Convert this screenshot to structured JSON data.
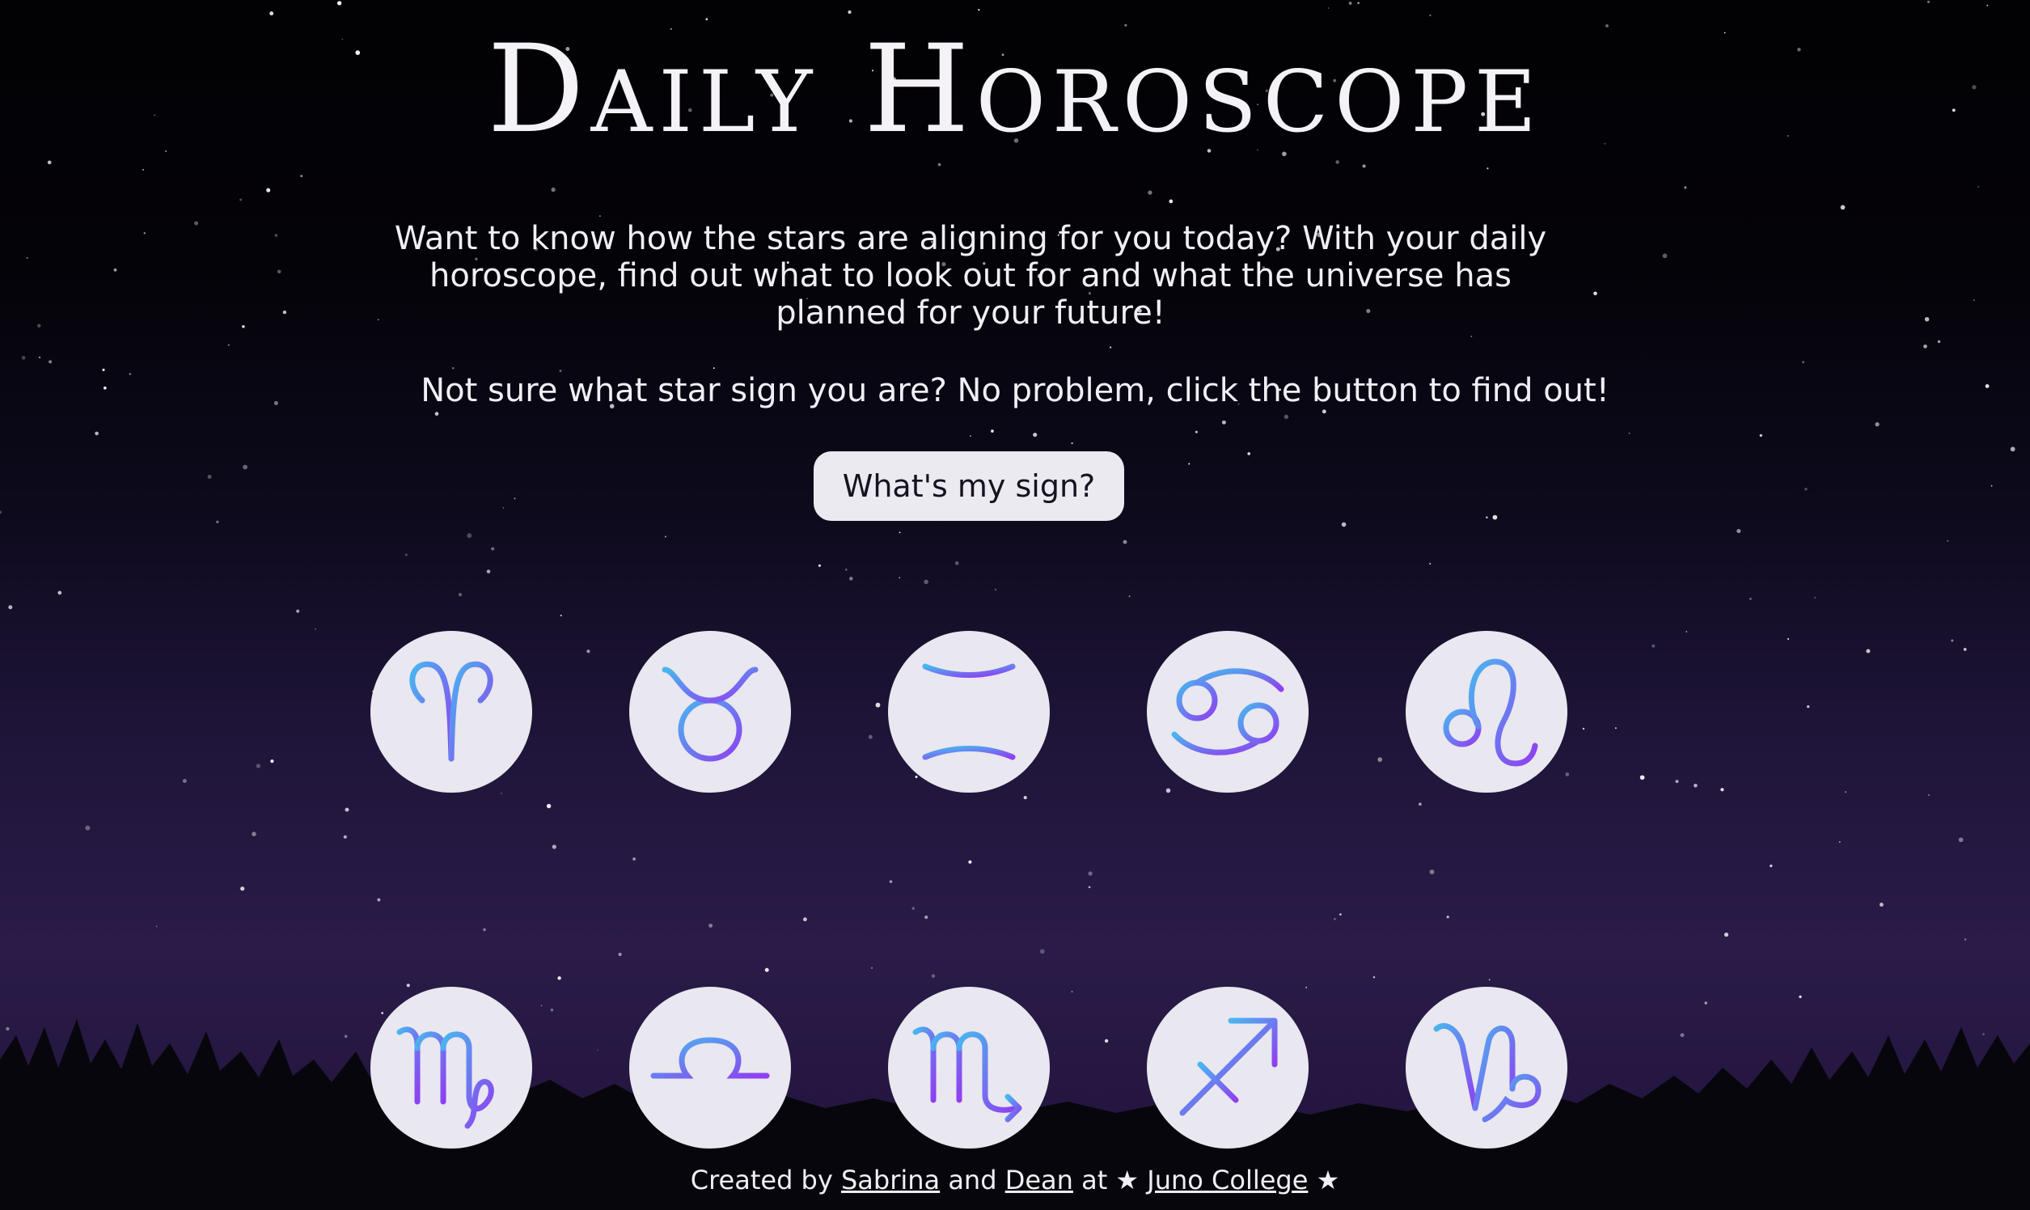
{
  "title": "Daily Horoscope",
  "intro": "Want to know how the stars are aligning for you today? With your daily horoscope, find out what to look out for and what the universe has planned for your future!",
  "prompt": "Not sure what star sign you are? No problem, click the button to find out!",
  "button": "What's my sign?",
  "signs": [
    {
      "name": "aries",
      "icon": "aries-icon"
    },
    {
      "name": "taurus",
      "icon": "taurus-icon"
    },
    {
      "name": "gemini",
      "icon": "gemini-icon"
    },
    {
      "name": "cancer",
      "icon": "cancer-icon"
    },
    {
      "name": "leo",
      "icon": "leo-icon"
    },
    {
      "name": "virgo",
      "icon": "virgo-icon"
    },
    {
      "name": "libra",
      "icon": "libra-icon"
    },
    {
      "name": "scorpio",
      "icon": "scorpio-icon"
    },
    {
      "name": "sagittarius",
      "icon": "sagittarius-icon"
    },
    {
      "name": "capricorn",
      "icon": "capricorn-icon"
    }
  ],
  "footer": {
    "created_by": "Created by",
    "author1": "Sabrina",
    "and": "and",
    "author2": "Dean",
    "at": "at",
    "star": "★",
    "school": "Juno College"
  },
  "colors": {
    "icon_gradient_start": "#48b6f0",
    "icon_gradient_end": "#8f3ff0",
    "circle": "#e9e7ef",
    "button_bg": "#eceaf1"
  }
}
